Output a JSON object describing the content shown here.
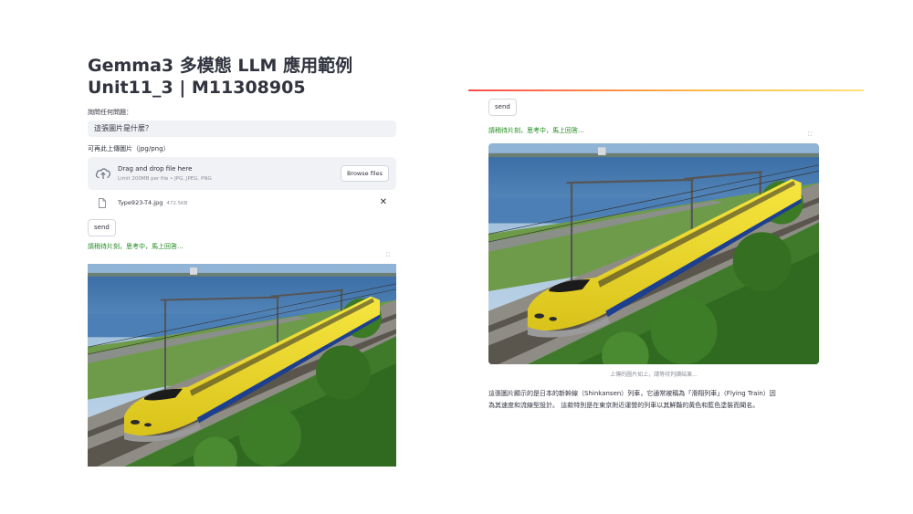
{
  "left": {
    "title_line1": "Gemma3 多模態 LLM 應用範例",
    "title_line2": "Unit11_3 | M11308905",
    "question_label": "詢問任何問題：",
    "question_value": "這張圖片是什麼？",
    "upload_label": "可再此上傳圖片（jpg/png）",
    "uploader": {
      "drag_text": "Drag and drop file here",
      "limit_text": "Limit 200MB per file • JPG, JPEG, PNG",
      "browse_label": "Browse files",
      "icon": "cloud-upload-icon"
    },
    "file": {
      "name": "Type923-T4.jpg",
      "size": "472.5KB",
      "close": "✕"
    },
    "send_label": "send",
    "status_text": "請稍待片刻，思考中，馬上回答...",
    "expand_glyph": "⛶"
  },
  "right": {
    "send_label": "send",
    "status_text": "請稍待片刻，思考中，馬上回答...",
    "expand_glyph": "⛶",
    "caption": "上傳的圖片如上，請等待判讀結果...",
    "answer_line1": "這張圖片顯示的是日本的新幹線（Shinkansen）列車，它通常被稱為「滑翔列車」（Flying Train）因",
    "answer_line2": "為其速度和流線型設計。 這款特別是在東京附近運營的列車以其鮮豔的黃色和藍色塗裝而聞名。"
  },
  "colors": {
    "status_green": "#1f8a1f",
    "train_yellow": "#f2de1f",
    "stripe_blue": "#1d3f8f",
    "divider_red": "#ff4b4b",
    "divider_yellow": "#ffbd45"
  }
}
